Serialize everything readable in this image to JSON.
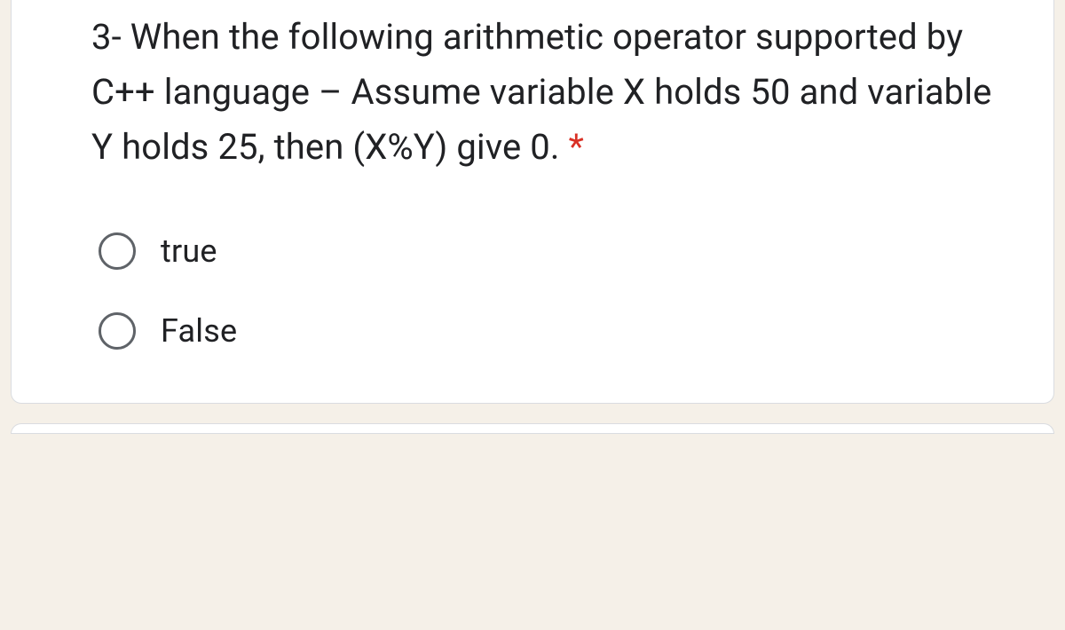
{
  "question": {
    "text": "3- When the following arithmetic operator supported by C++ language – Assume variable X holds 50 and variable Y holds 25, then (X%Y) give 0. ",
    "required_marker": "*"
  },
  "options": [
    {
      "label": "true"
    },
    {
      "label": "False"
    }
  ]
}
